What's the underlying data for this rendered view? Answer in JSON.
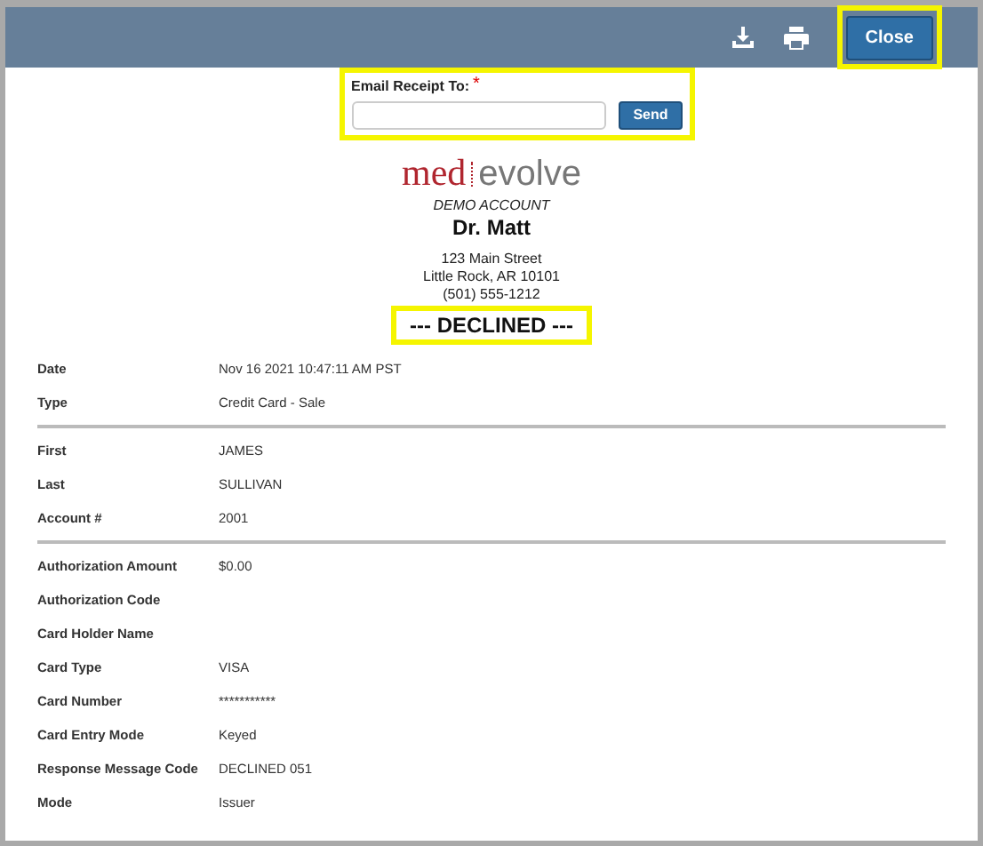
{
  "toolbar": {
    "close_label": "Close"
  },
  "email": {
    "label": "Email Receipt To:",
    "required_mark": "*",
    "send_label": "Send"
  },
  "merchant": {
    "logo_left": "med",
    "logo_right": "evolve",
    "account_label": "DEMO ACCOUNT",
    "name": "Dr. Matt",
    "address": [
      "123 Main Street",
      "Little Rock, AR 10101",
      "(501) 555-1212"
    ]
  },
  "status": "--- DECLINED ---",
  "sections": [
    {
      "rows": [
        {
          "label": "Date",
          "value": "Nov 16 2021 10:47:11 AM PST"
        },
        {
          "label": "Type",
          "value": "Credit Card - Sale"
        }
      ]
    },
    {
      "rows": [
        {
          "label": "First",
          "value": "JAMES"
        },
        {
          "label": "Last",
          "value": "SULLIVAN"
        },
        {
          "label": "Account #",
          "value": "2001"
        }
      ]
    },
    {
      "rows": [
        {
          "label": "Authorization Amount",
          "value": "$0.00"
        },
        {
          "label": "Authorization Code"
        },
        {
          "label": "Card Holder Name"
        },
        {
          "label": "Card Type",
          "value": "VISA"
        },
        {
          "label": "Card Number",
          "value": "***********"
        },
        {
          "label": "Card Entry Mode",
          "value": "Keyed"
        },
        {
          "label": "Response Message Code",
          "value": "DECLINED 051"
        },
        {
          "label": "Mode",
          "value": "Issuer"
        }
      ]
    }
  ]
}
